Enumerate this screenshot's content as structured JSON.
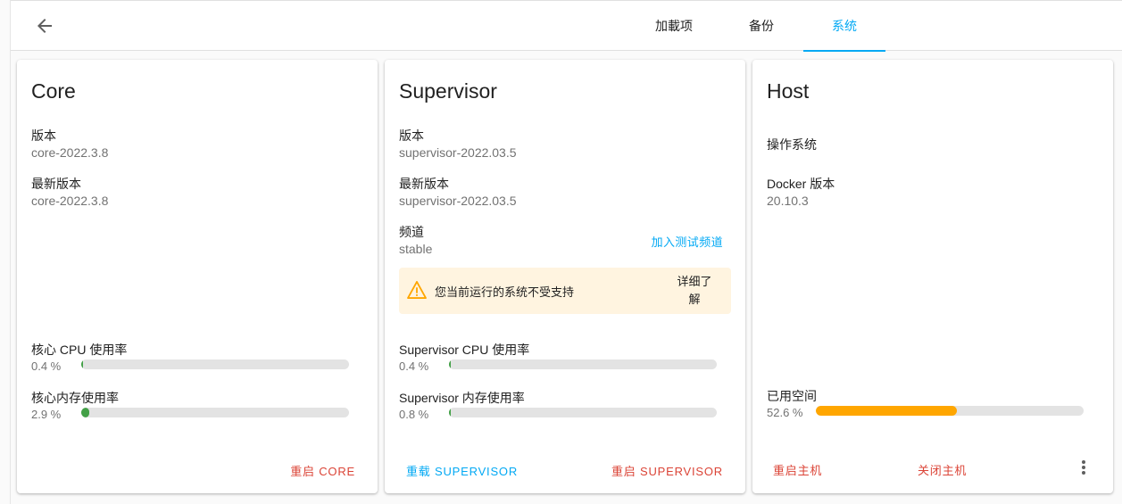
{
  "topbar": {
    "back_icon": "arrow-left-icon",
    "tabs": [
      {
        "label": "加載项",
        "active": false
      },
      {
        "label": "备份",
        "active": false
      },
      {
        "label": "系统",
        "active": true
      }
    ]
  },
  "colors": {
    "accent": "#03a9f4",
    "danger": "#db4437",
    "success": "#43a047",
    "warning": "#ffa600"
  },
  "core": {
    "title": "Core",
    "version_label": "版本",
    "version_value": "core-2022.3.8",
    "latest_label": "最新版本",
    "latest_value": "core-2022.3.8",
    "cpu_label": "核心 CPU 使用率",
    "cpu_value": "0.4 %",
    "cpu_fraction": 0.004,
    "mem_label": "核心内存使用率",
    "mem_value": "2.9 %",
    "mem_fraction": 0.029,
    "restart_label": "重启 CORE"
  },
  "supervisor": {
    "title": "Supervisor",
    "version_label": "版本",
    "version_value": "supervisor-2022.03.5",
    "latest_label": "最新版本",
    "latest_value": "supervisor-2022.03.5",
    "channel_label": "频道",
    "channel_value": "stable",
    "join_beta_label": "加入测试频道",
    "warning_icon": "warning-triangle-icon",
    "warning_text": "您当前运行的系统不受支持",
    "learn_more_label": "详细了解",
    "cpu_label": "Supervisor CPU 使用率",
    "cpu_value": "0.4 %",
    "cpu_fraction": 0.004,
    "mem_label": "Supervisor 内存使用率",
    "mem_value": "0.8 %",
    "mem_fraction": 0.008,
    "reload_label": "重载 SUPERVISOR",
    "restart_label": "重启 SUPERVISOR"
  },
  "host": {
    "title": "Host",
    "os_label": "操作系统",
    "docker_label": "Docker 版本",
    "docker_value": "20.10.3",
    "disk_label": "已用空间",
    "disk_value": "52.6 %",
    "disk_fraction": 0.526,
    "reboot_label": "重启主机",
    "shutdown_label": "关闭主机",
    "menu_icon": "more-vertical-icon"
  }
}
